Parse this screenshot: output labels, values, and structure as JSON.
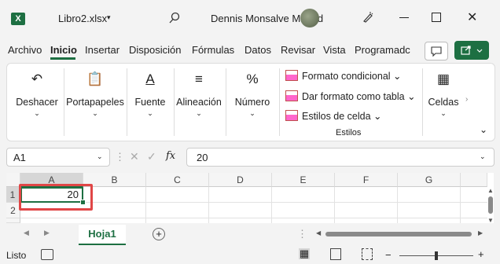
{
  "titlebar": {
    "app_icon": "X",
    "filename": "Libro2.xlsx",
    "user": "Dennis Monsalve Madrid"
  },
  "tabs": [
    "Archivo",
    "Inicio",
    "Insertar",
    "Disposición",
    "Fórmulas",
    "Datos",
    "Revisar",
    "Vista",
    "Programadc"
  ],
  "active_tab": "Inicio",
  "ribbon": {
    "undo": "Deshacer",
    "clipboard": "Portapapeles",
    "font": "Fuente",
    "alignment": "Alineación",
    "number": "Número",
    "number_icon": "%",
    "cond_format": "Formato condicional",
    "table_format": "Dar formato como tabla",
    "cell_styles": "Estilos de celda",
    "styles_group": "Estilos",
    "cells": "Celdas"
  },
  "formula_bar": {
    "name_box": "A1",
    "fx": "fx",
    "value": "20"
  },
  "grid": {
    "columns": [
      "A",
      "B",
      "C",
      "D",
      "E",
      "F",
      "G"
    ],
    "rows": [
      "1",
      "2"
    ],
    "a1": "20"
  },
  "sheet": {
    "tab": "Hoja1",
    "add": "+"
  },
  "status": {
    "text": "Listo"
  },
  "accent": "#1d6f42",
  "highlight_color": "#e04646"
}
